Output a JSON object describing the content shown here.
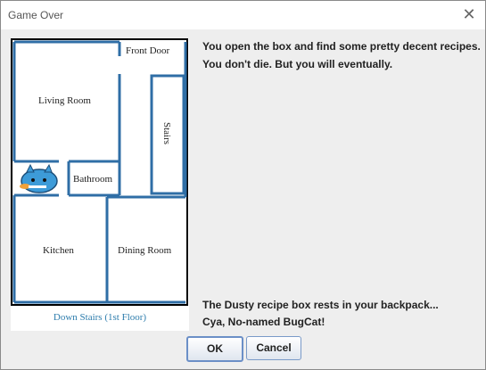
{
  "window": {
    "title": "Game Over",
    "close_glyph": "✕"
  },
  "map": {
    "rooms": {
      "front_door": "Front Door",
      "living_room": "Living Room",
      "stairs": "Stairs",
      "bathroom": "Bathroom",
      "kitchen": "Kitchen",
      "dining_room": "Dining Room"
    },
    "down_stairs": "Down Stairs (1st Floor)",
    "character_icon": "bugcat-icon"
  },
  "message": {
    "line1": "You open the box and find some pretty decent recipes.",
    "line2": "You don't die. But you will eventually.",
    "line3": "The Dusty recipe box rests in your backpack...",
    "line4": "Cya, No-named BugCat!"
  },
  "buttons": {
    "ok": "OK",
    "cancel": "Cancel"
  },
  "colors": {
    "wall_blue": "#2f6ea6",
    "wall_black": "#000000"
  }
}
